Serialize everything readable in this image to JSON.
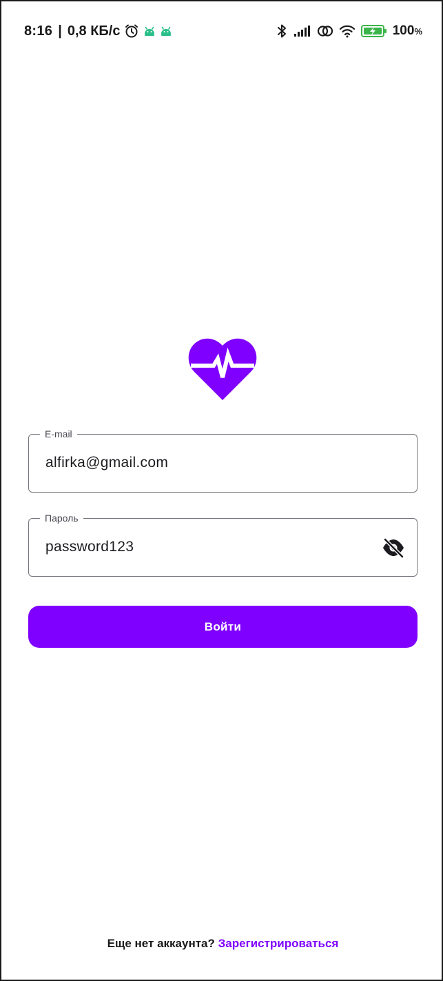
{
  "status_bar": {
    "time": "8:16",
    "separator": "|",
    "network_speed": "0,8 КБ/с",
    "left_icons": [
      "alarm-icon",
      "android-icon",
      "android-icon"
    ],
    "right_icons": [
      "bluetooth-icon",
      "signal-icon",
      "hotspot-icon",
      "wifi-icon",
      "battery-charging-icon"
    ],
    "battery_value": "100",
    "battery_unit": "%"
  },
  "logo": {
    "icon": "heart-pulse-icon",
    "color": "#7f00ff"
  },
  "email_field": {
    "label": "E-mail",
    "value": "alfirka@gmail.com"
  },
  "password_field": {
    "label": "Пароль",
    "value": "password123",
    "toggle_icon": "eye-off-icon"
  },
  "login_button": {
    "label": "Войти",
    "color": "#7f00ff"
  },
  "footer": {
    "prompt": "Еще нет аккаунта?",
    "link": "Зарегистрироваться",
    "link_color": "#7f00ff"
  }
}
